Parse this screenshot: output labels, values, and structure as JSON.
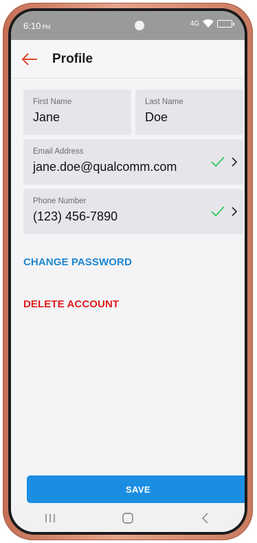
{
  "status_bar": {
    "time": "6:10",
    "period": "PM",
    "network": "4G"
  },
  "header": {
    "title": "Profile",
    "back_icon": "arrow-left-icon"
  },
  "form": {
    "first_name": {
      "label": "First Name",
      "value": "Jane"
    },
    "last_name": {
      "label": "Last Name",
      "value": "Doe"
    },
    "email": {
      "label": "Email Address",
      "value": "jane.doe@qualcomm.com",
      "verified": true
    },
    "phone": {
      "label": "Phone Number",
      "value": "(123) 456-7890",
      "verified": true
    }
  },
  "actions": {
    "change_password": "CHANGE PASSWORD",
    "delete_account": "DELETE ACCOUNT",
    "save": "SAVE"
  },
  "colors": {
    "accent": "#1b8ee1",
    "link": "#1d86d1",
    "danger": "#e01c1c",
    "check": "#2ec85a",
    "back_arrow": "#e0472e"
  },
  "nav_bar": {
    "icons": [
      "recent-apps-icon",
      "home-icon",
      "back-icon"
    ]
  }
}
